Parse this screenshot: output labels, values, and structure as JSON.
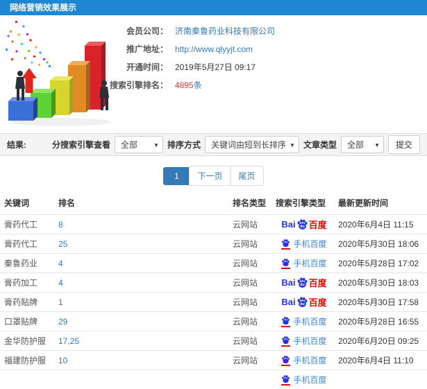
{
  "header": {
    "title": "网络营销效果展示"
  },
  "info": {
    "rows": [
      {
        "label": "会员公司：",
        "value": "济南秦鲁药业科技有限公司"
      },
      {
        "label": "推广地址：",
        "value": "http://www.qlyyjt.com"
      },
      {
        "label": "开通时间：",
        "value": "2019年5月27日 09:17"
      },
      {
        "label": "搜索引擎排名：",
        "value": "4895",
        "suffix": "条"
      }
    ]
  },
  "filters": {
    "result_label": "结果:",
    "engine_label": "分搜索引擎查看",
    "engine_value": "全部",
    "sort_label": "排序方式",
    "sort_value": "关键词由短到长排序",
    "article_label": "文章类型",
    "article_value": "全部",
    "submit_label": "提交"
  },
  "pagination": {
    "current": "1",
    "next_label": "下一页",
    "last_label": "尾页"
  },
  "table": {
    "headers": [
      "关键词",
      "排名",
      "排名类型",
      "搜索引擎类型",
      "最新更新时间"
    ],
    "rows": [
      {
        "keyword": "膏药代工",
        "rank": "8",
        "rank_type": "云网站",
        "engine": "baidu-pc",
        "updated": "2020年6月4日 11:15"
      },
      {
        "keyword": "膏药代工",
        "rank": "25",
        "rank_type": "云网站",
        "engine": "baidu-mobile",
        "updated": "2020年5月30日 18:06"
      },
      {
        "keyword": "秦鲁药业",
        "rank": "4",
        "rank_type": "云网站",
        "engine": "baidu-mobile",
        "updated": "2020年5月28日 17:02"
      },
      {
        "keyword": "膏药加工",
        "rank": "4",
        "rank_type": "云网站",
        "engine": "baidu-pc",
        "updated": "2020年5月30日 18:03"
      },
      {
        "keyword": "膏药贴牌",
        "rank": "1",
        "rank_type": "云网站",
        "engine": "baidu-pc",
        "updated": "2020年5月30日 17:58"
      },
      {
        "keyword": "口罩贴牌",
        "rank": "29",
        "rank_type": "云网站",
        "engine": "baidu-mobile",
        "updated": "2020年5月28日 16:55"
      },
      {
        "keyword": "金华防护服",
        "rank": "17,25",
        "rank_type": "云网站",
        "engine": "baidu-mobile",
        "updated": "2020年6月20日 09:25"
      },
      {
        "keyword": "福建防护服",
        "rank": "10",
        "rank_type": "云网站",
        "engine": "baidu-mobile",
        "updated": "2020年6月4日 11:10"
      },
      {
        "keyword": "",
        "rank": "",
        "rank_type": "",
        "engine": "baidu-mobile",
        "updated": "",
        "partial": true
      }
    ]
  },
  "engines": {
    "baidu_pc": {
      "bai": "Bai",
      "du": "du",
      "suffix": "百度"
    },
    "baidu_mobile": {
      "label": "手机百度"
    }
  },
  "colors": {
    "header_blue": "#1e87d4",
    "link_blue": "#337ab7",
    "count_red": "#e4393c",
    "baidu_blue": "#2932e1",
    "baidu_red": "#e10600",
    "mobile_text_blue": "#3a87d8"
  }
}
